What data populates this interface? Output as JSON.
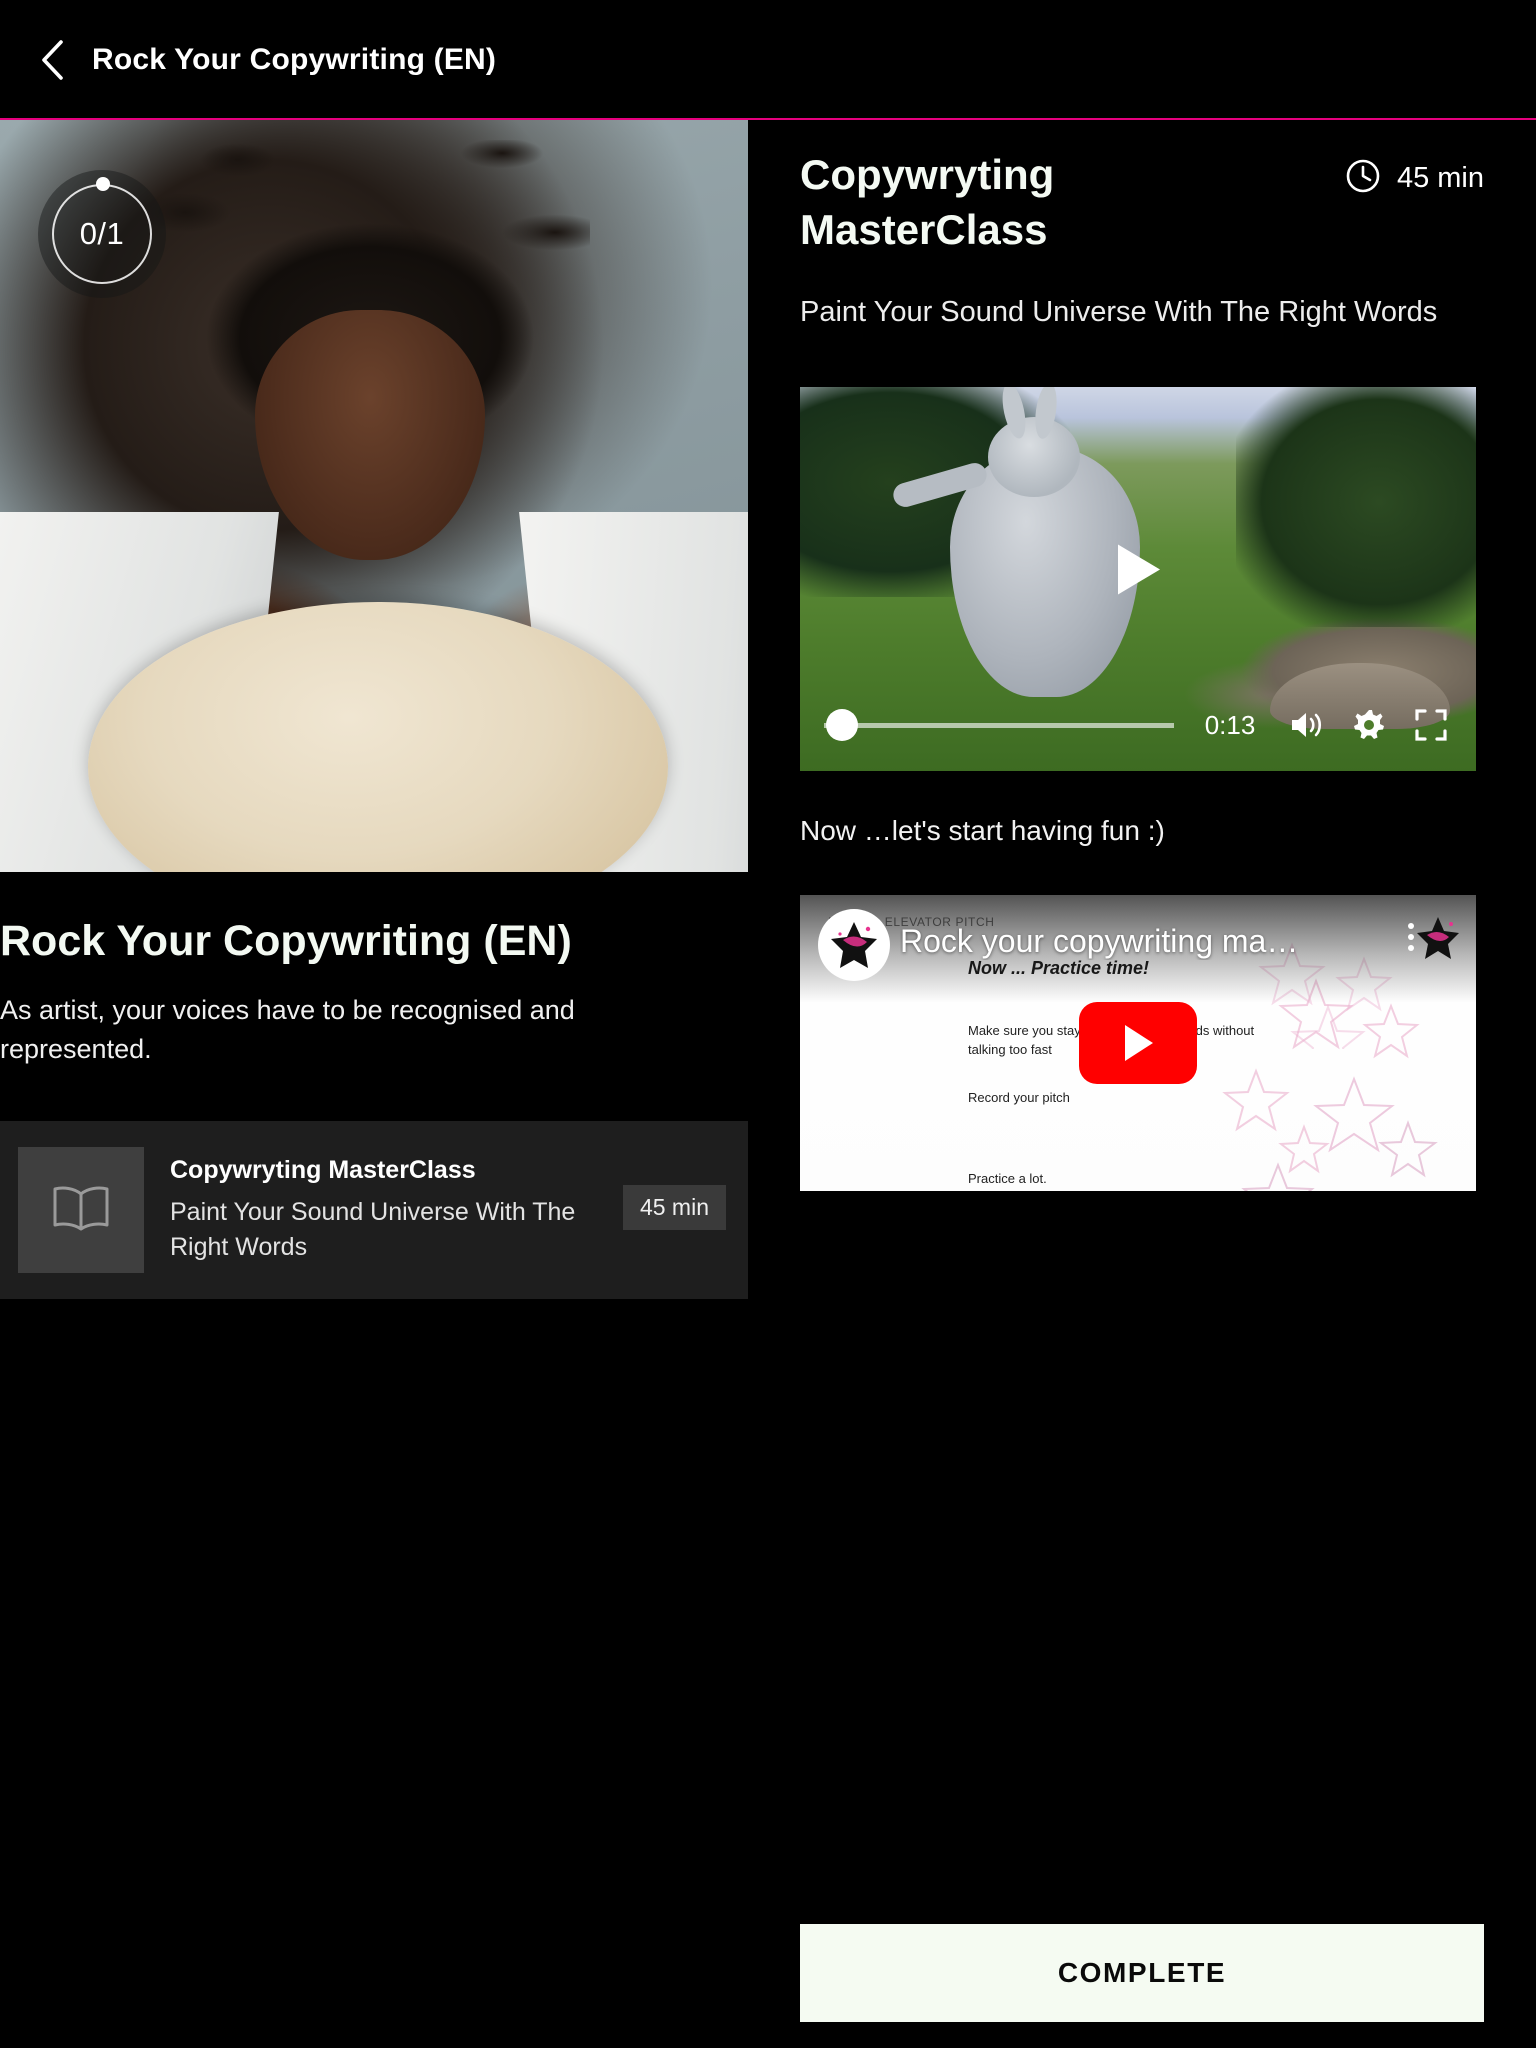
{
  "header": {
    "back_icon": "chevron-left-icon",
    "title": "Rock Your Copywriting (EN)",
    "rule_color": "#e6007e"
  },
  "left": {
    "progress": {
      "label": "0/1",
      "completed": 0,
      "total": 1
    },
    "course_title": "Rock Your Copywriting (EN)",
    "course_description": "As artist, your voices have to be recognised and represented.",
    "lesson_card": {
      "icon": "book-icon",
      "title": "Copywryting MasterClass",
      "subtitle": " Paint Your Sound Universe With The Right Words",
      "duration": "45 min"
    }
  },
  "right": {
    "title": "Copywryting MasterClass",
    "duration_icon": "clock-icon",
    "duration": "45 min",
    "subtitle": " Paint Your Sound Universe With The Right Words",
    "video_player": {
      "play_icon": "play-icon",
      "current_time": "0:13",
      "volume_icon": "volume-icon",
      "settings_icon": "gear-icon",
      "fullscreen_icon": "fullscreen-icon"
    },
    "note": "Now …let's start having fun :)",
    "youtube": {
      "video_title": "Rock your copywriting ma…",
      "play_icon": "youtube-play-icon",
      "kebab_icon": "more-options-icon",
      "channel_avatar": "channel-avatar",
      "slide": {
        "eyebrow": "PART 3 - ELEVATOR PITCH",
        "heading": "Now ... Practice time!",
        "line1": "Make sure you stay within the 30 seconds without talking too fast",
        "line2": "Record your pitch",
        "line3": "Practice a lot."
      }
    },
    "complete_label": "COMPLETE"
  }
}
